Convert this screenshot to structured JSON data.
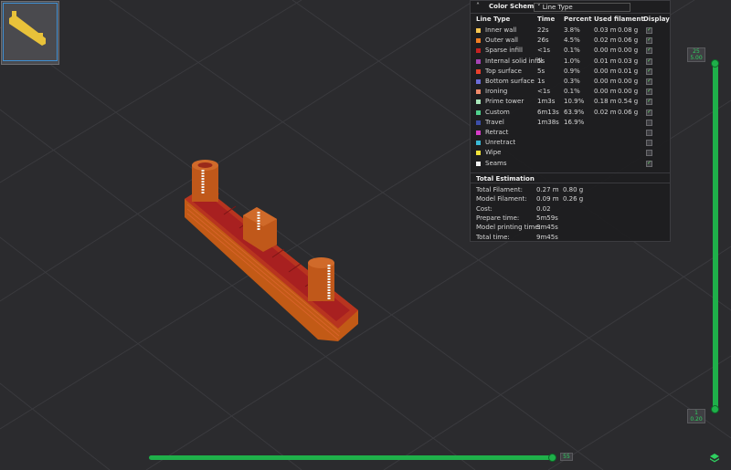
{
  "color_scheme": {
    "label": "Color Scheme",
    "selected": "Line Type",
    "columns": [
      "Line Type",
      "Time",
      "Percent",
      "Used filament",
      "Display"
    ],
    "rows": [
      {
        "name": "Inner wall",
        "time": "22s",
        "percent": "3.8%",
        "length": "0.03 m",
        "weight": "0.08 g",
        "color": "#f5c451",
        "display": true
      },
      {
        "name": "Outer wall",
        "time": "26s",
        "percent": "4.5%",
        "length": "0.02 m",
        "weight": "0.06 g",
        "color": "#f07d24",
        "display": true
      },
      {
        "name": "Sparse infill",
        "time": "<1s",
        "percent": "0.1%",
        "length": "0.00 m",
        "weight": "0.00 g",
        "color": "#c52222",
        "display": true
      },
      {
        "name": "Internal solid infill",
        "time": "5s",
        "percent": "1.0%",
        "length": "0.01 m",
        "weight": "0.03 g",
        "color": "#a543b4",
        "display": true
      },
      {
        "name": "Top surface",
        "time": "5s",
        "percent": "0.9%",
        "length": "0.00 m",
        "weight": "0.01 g",
        "color": "#e8402d",
        "display": true
      },
      {
        "name": "Bottom surface",
        "time": "1s",
        "percent": "0.3%",
        "length": "0.00 m",
        "weight": "0.00 g",
        "color": "#6c6cd6",
        "display": true
      },
      {
        "name": "Ironing",
        "time": "<1s",
        "percent": "0.1%",
        "length": "0.00 m",
        "weight": "0.00 g",
        "color": "#f08a6b",
        "display": true
      },
      {
        "name": "Prime tower",
        "time": "1m3s",
        "percent": "10.9%",
        "length": "0.18 m",
        "weight": "0.54 g",
        "color": "#a8e6b9",
        "display": true
      },
      {
        "name": "Custom",
        "time": "6m13s",
        "percent": "63.9%",
        "length": "0.02 m",
        "weight": "0.06 g",
        "color": "#4fd08c",
        "display": true
      },
      {
        "name": "Travel",
        "time": "1m38s",
        "percent": "16.9%",
        "length": "",
        "weight": "",
        "color": "#3c4ea8",
        "display": false
      },
      {
        "name": "Retract",
        "time": "",
        "percent": "",
        "length": "",
        "weight": "",
        "color": "#d63cc9",
        "display": false
      },
      {
        "name": "Unretract",
        "time": "",
        "percent": "",
        "length": "",
        "weight": "",
        "color": "#3ab8d6",
        "display": false
      },
      {
        "name": "Wipe",
        "time": "",
        "percent": "",
        "length": "",
        "weight": "",
        "color": "#f2e33a",
        "display": false
      },
      {
        "name": "Seams",
        "time": "",
        "percent": "",
        "length": "",
        "weight": "",
        "color": "#f2f2f2",
        "display": true
      }
    ]
  },
  "total_estimation": {
    "title": "Total Estimation",
    "items": [
      {
        "label": "Total Filament:",
        "value": "0.27 m",
        "extra": "0.80 g"
      },
      {
        "label": "Model Filament:",
        "value": "0.09 m",
        "extra": "0.26 g"
      },
      {
        "label": "Cost:",
        "value": "0.02",
        "extra": ""
      },
      {
        "label": "Prepare time:",
        "value": "5m59s",
        "extra": ""
      },
      {
        "label": "Model printing time:",
        "value": "3m45s",
        "extra": ""
      },
      {
        "label": "Total time:",
        "value": "9m45s",
        "extra": ""
      }
    ]
  },
  "layer_slider": {
    "top_layer": "25",
    "top_height": "5.00",
    "bottom_layer": "1",
    "bottom_height": "0.20"
  },
  "move_slider": {
    "value": "55"
  },
  "icons": {
    "collapse": "chevron-up-icon",
    "dropdown": "chevron-down-icon",
    "layers": "layers-icon"
  }
}
